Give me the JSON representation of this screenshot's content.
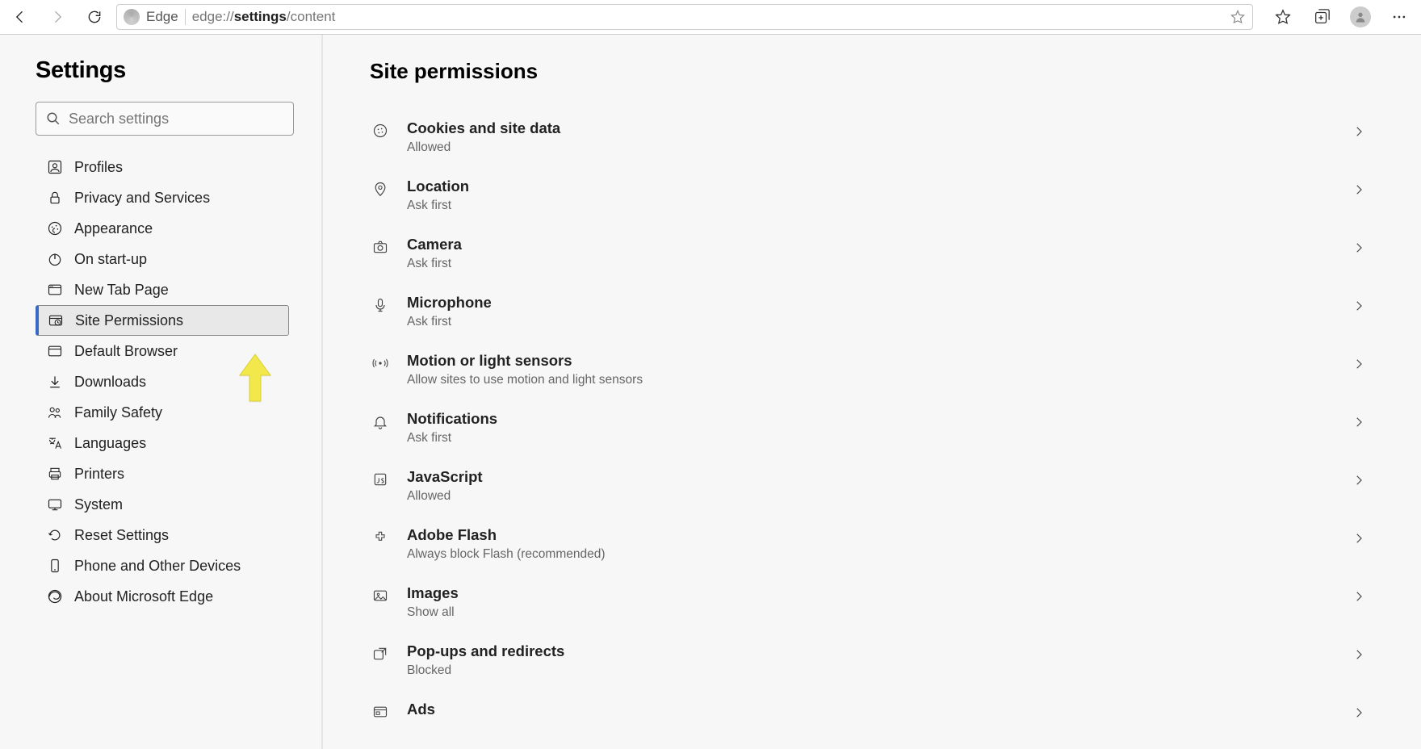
{
  "chrome": {
    "tab_label": "Edge",
    "url_prefix": "edge://",
    "url_bold": "settings",
    "url_suffix": "/content"
  },
  "sidebar": {
    "title": "Settings",
    "search_placeholder": "Search settings",
    "items": [
      {
        "id": "profiles",
        "label": "Profiles",
        "icon": "profile-icon"
      },
      {
        "id": "privacy",
        "label": "Privacy and Services",
        "icon": "lock-icon"
      },
      {
        "id": "appearance",
        "label": "Appearance",
        "icon": "palette-icon"
      },
      {
        "id": "startup",
        "label": "On start-up",
        "icon": "power-icon"
      },
      {
        "id": "newtab",
        "label": "New Tab Page",
        "icon": "newtab-icon"
      },
      {
        "id": "sitepermissions",
        "label": "Site Permissions",
        "icon": "permissions-icon",
        "active": true
      },
      {
        "id": "defaultbrowser",
        "label": "Default Browser",
        "icon": "window-icon"
      },
      {
        "id": "downloads",
        "label": "Downloads",
        "icon": "download-icon"
      },
      {
        "id": "family",
        "label": "Family Safety",
        "icon": "family-icon"
      },
      {
        "id": "languages",
        "label": "Languages",
        "icon": "languages-icon"
      },
      {
        "id": "printers",
        "label": "Printers",
        "icon": "printer-icon"
      },
      {
        "id": "system",
        "label": "System",
        "icon": "system-icon"
      },
      {
        "id": "reset",
        "label": "Reset Settings",
        "icon": "reset-icon"
      },
      {
        "id": "devices",
        "label": "Phone and Other Devices",
        "icon": "phone-icon"
      },
      {
        "id": "about",
        "label": "About Microsoft Edge",
        "icon": "edge-icon"
      }
    ]
  },
  "content": {
    "heading": "Site permissions",
    "items": [
      {
        "id": "cookies",
        "title": "Cookies and site data",
        "sub": "Allowed",
        "icon": "cookie-icon"
      },
      {
        "id": "location",
        "title": "Location",
        "sub": "Ask first",
        "icon": "location-icon"
      },
      {
        "id": "camera",
        "title": "Camera",
        "sub": "Ask first",
        "icon": "camera-icon"
      },
      {
        "id": "microphone",
        "title": "Microphone",
        "sub": "Ask first",
        "icon": "microphone-icon"
      },
      {
        "id": "motion",
        "title": "Motion or light sensors",
        "sub": "Allow sites to use motion and light sensors",
        "icon": "sensor-icon"
      },
      {
        "id": "notifications",
        "title": "Notifications",
        "sub": "Ask first",
        "icon": "notification-icon"
      },
      {
        "id": "javascript",
        "title": "JavaScript",
        "sub": "Allowed",
        "icon": "javascript-icon"
      },
      {
        "id": "flash",
        "title": "Adobe Flash",
        "sub": "Always block Flash (recommended)",
        "icon": "plugin-icon"
      },
      {
        "id": "images",
        "title": "Images",
        "sub": "Show all",
        "icon": "image-icon"
      },
      {
        "id": "popups",
        "title": "Pop-ups and redirects",
        "sub": "Blocked",
        "icon": "popup-icon"
      },
      {
        "id": "ads",
        "title": "Ads",
        "sub": "",
        "icon": "ads-icon"
      }
    ]
  },
  "annotation": {
    "type": "arrow-up",
    "color": "#f2e84b"
  }
}
